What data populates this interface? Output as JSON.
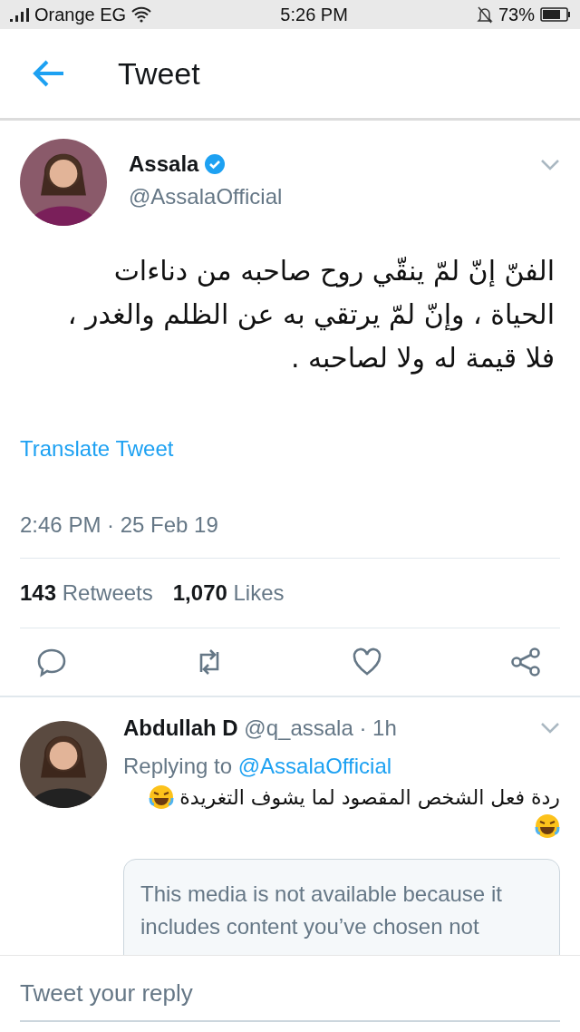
{
  "status_bar": {
    "carrier": "Orange EG",
    "time": "5:26 PM",
    "battery": "73%"
  },
  "header": {
    "title": "Tweet"
  },
  "tweet": {
    "author": "Assala",
    "verified": true,
    "handle": "@AssalaOfficial",
    "text": "الفنّ إنّ لمّ ينقّي روح صاحبه من دناءات الحياة ، وإنّ لمّ يرتقي به عن الظلم والغدر ، فلا قيمة له ولا لصاحبه .",
    "translate": "Translate Tweet",
    "timestamp": "2:46 PM · 25 Feb 19",
    "retweets_count": "143",
    "retweets_label": "Retweets",
    "likes_count": "1,070",
    "likes_label": "Likes"
  },
  "reply": {
    "author": "Abdullah D",
    "handle": "@q_assala · 1h",
    "replying_label": "Replying to",
    "replying_handle": "@AssalaOfficial",
    "text": "ردة فعل الشخص المقصود لما يشوف التغريدة",
    "media_notice": "This media is not available because it includes content you’ve chosen not"
  },
  "composer": {
    "placeholder": "Tweet your reply"
  }
}
